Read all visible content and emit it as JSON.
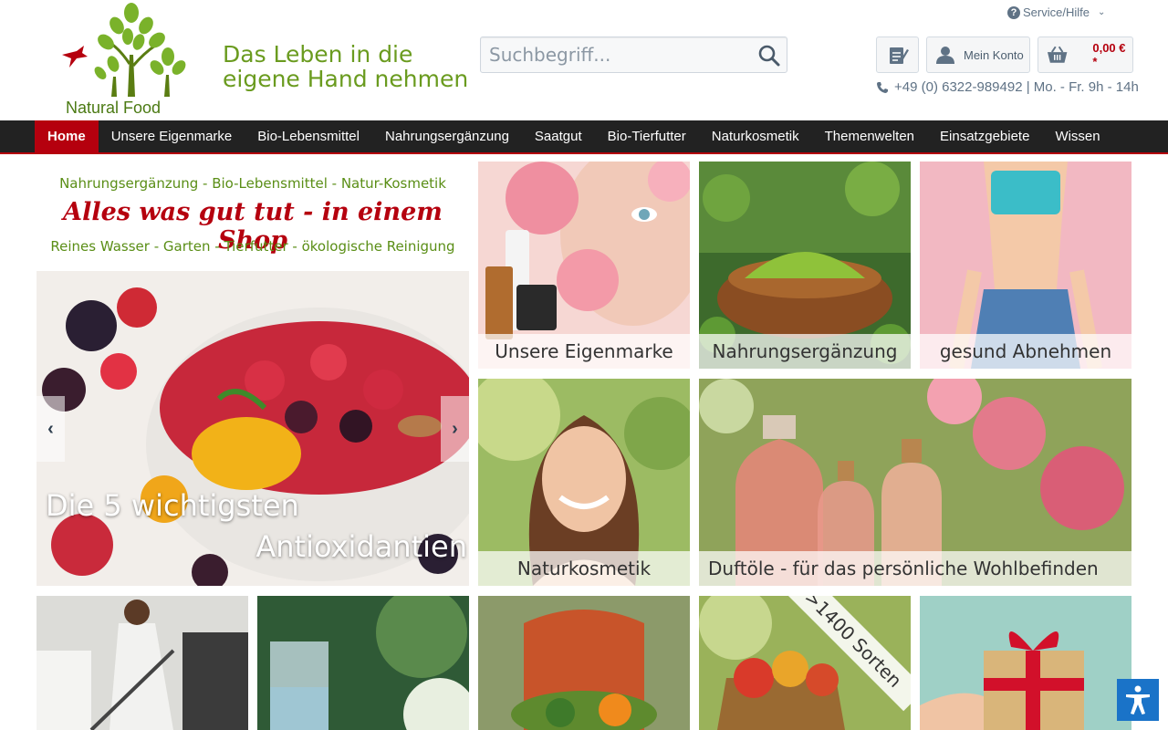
{
  "header": {
    "brand_name": "Natural Food",
    "slogan_line1": "Das Leben in die",
    "slogan_line2": "eigene Hand nehmen",
    "search_placeholder": "Suchbegriff...",
    "service_label": "Service/Hilfe",
    "account_label": "Mein Konto",
    "cart_amount": "0,00 € *",
    "phone_text": "+49 (0) 6322-989492 | Mo. - Fr. 9h - 14h"
  },
  "nav": {
    "items": [
      {
        "label": "Home",
        "active": true
      },
      {
        "label": "Unsere Eigenmarke"
      },
      {
        "label": "Bio-Lebensmittel"
      },
      {
        "label": "Nahrungsergänzung"
      },
      {
        "label": "Saatgut"
      },
      {
        "label": "Bio-Tierfutter"
      },
      {
        "label": "Naturkosmetik"
      },
      {
        "label": "Themenwelten"
      },
      {
        "label": "Einsatzgebiete"
      },
      {
        "label": "Wissen"
      }
    ]
  },
  "hero": {
    "line1": "Nahrungsergänzung - Bio-Lebensmittel - Natur-Kosmetik",
    "line2": "Alles was gut tut - in einem Shop",
    "line3": "Reines Wasser - Garten - Tierfutter - ökologische Reinigung",
    "caption1": "Die 5 wichtigsten",
    "caption2": "Antioxidantien"
  },
  "tiles": {
    "eigenmarke": "Unsere Eigenmarke",
    "nahrung": "Nahrungsergänzung",
    "abnehmen": "gesund Abnehmen",
    "naturkosmetik": "Naturkosmetik",
    "duftoele": "Duftöle - für das persönliche Wohlbefinden",
    "sorten_badge": ">1400 Sorten"
  },
  "colors": {
    "nav_bg": "#222222",
    "accent": "#b5000e",
    "brand_green": "#6a9b1f",
    "a11y_blue": "#1a73c8"
  }
}
